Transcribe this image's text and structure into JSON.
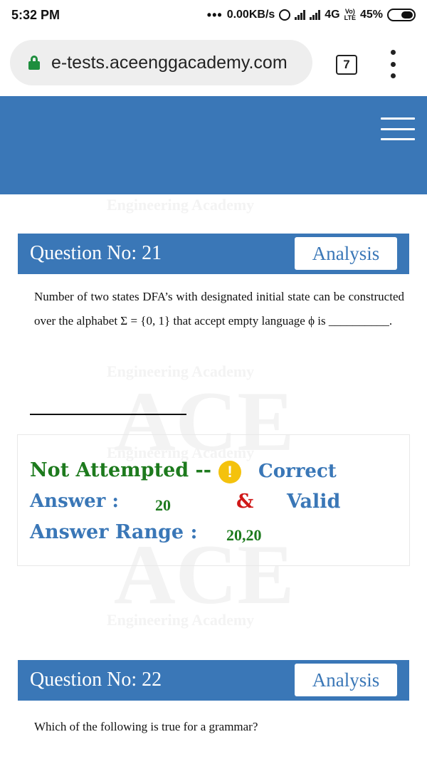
{
  "status_bar": {
    "time": "5:32 PM",
    "network_speed": "0.00KB/s",
    "network_type": "4G",
    "volte_label_top": "Vo)",
    "volte_label_bottom": "LTE",
    "battery": "45%",
    "battery_level": 0.45,
    "icons": [
      "more-dots-icon",
      "alarm-icon",
      "signal-icon",
      "signal-icon",
      "volte-icon",
      "battery-icon"
    ]
  },
  "browser": {
    "url": "e-tests.aceenggacademy.com",
    "tab_count": "7",
    "secure": true,
    "icons": [
      "lock-icon",
      "tabs-icon",
      "menu-icon"
    ]
  },
  "header": {
    "icon": "hamburger-menu-icon",
    "color": "#3a77b7"
  },
  "watermark": {
    "big_text": "ACE",
    "small_text": "Engineering Academy"
  },
  "questions": [
    {
      "title": "Question No: 21",
      "analysis_label": "Analysis",
      "text": "Number of two states DFA’s with designated initial state can be constructed over the alphabet Σ = {0, 1} that accept empty language ϕ is __________."
    },
    {
      "title": "Question No: 22",
      "analysis_label": "Analysis",
      "text": "Which of the following is true for a grammar?"
    }
  ],
  "result": {
    "status": "Not Attempted --",
    "status_icon": "warning-icon",
    "correct_label": "Correct",
    "answer_label": "Answer :",
    "answer_value": "20",
    "amp": "&",
    "valid_label": "Valid",
    "range_label": "Answer Range :",
    "range_value": "20,20"
  },
  "colors": {
    "brand_blue": "#3a77b7",
    "green": "#1d7a1d",
    "red": "#d01818",
    "warning": "#f4c20d"
  }
}
